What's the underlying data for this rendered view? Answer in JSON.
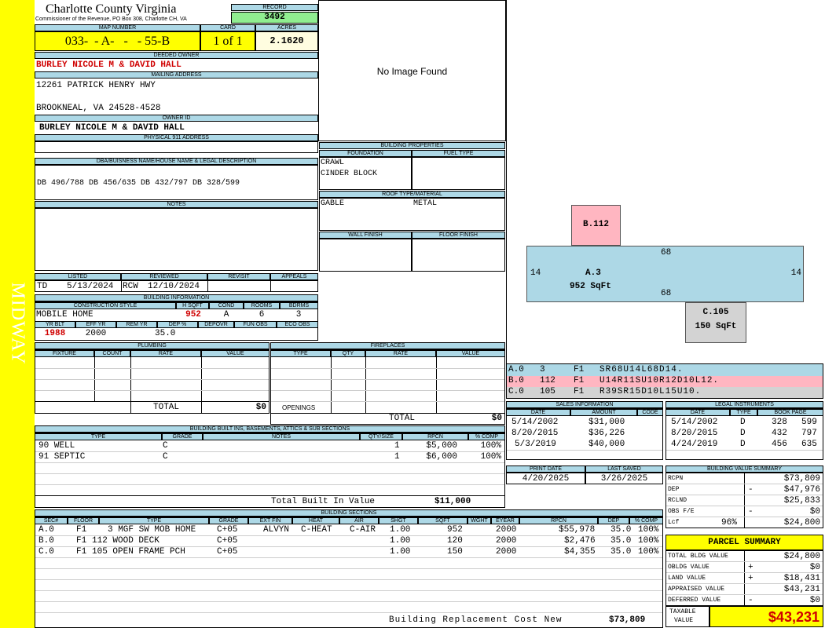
{
  "side_label": "MIDWAY",
  "county": {
    "name": "Charlotte County Virginia",
    "sub": "Commissioner of the Revenue, PO Box 308, Charlotte CH, VA"
  },
  "record": {
    "label": "RECORD",
    "value": "3492"
  },
  "map": {
    "label": "MAP NUMBER",
    "value": "033-  - A-   -   - 55-B",
    "card_label": "CARD",
    "card": "1 of 1",
    "acres_label": "ACRES",
    "acres": "2.1620"
  },
  "owner": {
    "deeded_label": "DEEDED OWNER",
    "deeded": "BURLEY NICOLE M & DAVID HALL",
    "mailing_label": "MAILING ADDRESS",
    "addr1": "12261 PATRICK HENRY HWY",
    "addr2": "BROOKNEAL, VA 24528-4528",
    "id_label": "OWNER ID",
    "id_value": "BURLEY NICOLE M & DAVID HALL",
    "phys_label": "PHYSICAL 911 ADDRESS"
  },
  "legal": {
    "label": "DBA/BUISNESS NAME/HOUSE NAME & LEGAL DESCRIPTION",
    "value": "DB 496/788 DB 456/635 DB 432/797 DB 328/599"
  },
  "notes_label": "NOTES",
  "image_text": "No Image Found",
  "review": {
    "listed_label": "LISTED",
    "listed_by": "TD",
    "listed": "5/13/2024",
    "reviewed_label": "REVIEWED",
    "reviewed_by": "RCW",
    "reviewed": "12/10/2024",
    "revisit_label": "REVISIT",
    "appeals_label": "APPEALS"
  },
  "building_info": {
    "label": "BUILDING INFORMATION",
    "style_label": "CONSTRUCTION STYLE",
    "style": "MOBILE HOME",
    "hsqft_label": "H SQFT",
    "hsqft": "952",
    "cond_label": "COND",
    "cond": "A",
    "rooms_label": "ROOMS",
    "rooms": "6",
    "bdrms_label": "BDRMS",
    "bdrms": "3",
    "yrblt_label": "YR BLT",
    "yrblt": "1988",
    "effyr_label": "EFF YR",
    "effyr": "2000",
    "remyr_label": "REM YR",
    "deppct_label": "DEP %",
    "deppct": "35.0",
    "depovr_label": "DEPOVR",
    "funobs_label": "FUN OBS",
    "ecoobs_label": "ECO OBS"
  },
  "props": {
    "label": "BUILDING PROPERTIES",
    "foundation_label": "FOUNDATION",
    "foundation1": "CRAWL",
    "foundation2": "CINDER BLOCK",
    "fuel_label": "FUEL TYPE",
    "roof_label": "ROOF TYPE/MATERIAL",
    "roof_type": "GABLE",
    "roof_mat": "METAL",
    "wall_label": "WALL FINISH",
    "floor_label": "FLOOR FINISH"
  },
  "sketch": {
    "b_label": "B.112",
    "a_label": "A.3",
    "a_area": "952 SqFt",
    "a_top": "68",
    "a_bottom": "68",
    "a_left": "14",
    "a_right": "14",
    "c_label": "C.105",
    "c_area": "150 SqFt",
    "colors": {
      "a": "#add8e6",
      "b": "#ffb6c1",
      "c": "#d3d3d3"
    }
  },
  "sketch_codes": [
    {
      "id": "A.0",
      "num": "3",
      "fl": "F1",
      "code": "SR68U14L68D14."
    },
    {
      "id": "B.0",
      "num": "112",
      "fl": "F1",
      "code": "U14R11SU10R12D10L12."
    },
    {
      "id": "C.0",
      "num": "105",
      "fl": "F1",
      "code": "R39SR15D10L15U10."
    }
  ],
  "plumbing": {
    "label": "PLUMBING",
    "cols": [
      "FIXTURE",
      "COUNT",
      "RATE",
      "VALUE"
    ],
    "total_label": "TOTAL",
    "total": "$0"
  },
  "fireplaces": {
    "label": "FIREPLACES",
    "cols": [
      "TYPE",
      "QTY",
      "RATE",
      "VALUE"
    ],
    "openings_label": "OPENINGS",
    "total_label": "TOTAL",
    "total": "$0"
  },
  "sales": {
    "label": "SALES INFORMATION",
    "cols": [
      "DATE",
      "AMOUNT",
      "CODE"
    ],
    "rows": [
      {
        "date": "5/14/2002",
        "amount": "$31,000",
        "code": ""
      },
      {
        "date": "8/20/2015",
        "amount": "$36,226",
        "code": ""
      },
      {
        "date": "5/3/2019",
        "amount": "$40,000",
        "code": ""
      }
    ]
  },
  "legal_instr": {
    "label": "LEGAL INSTRUMENTS",
    "cols": [
      "DATE",
      "TYPE",
      "BOOK PAGE"
    ],
    "rows": [
      {
        "date": "5/14/2002",
        "type": "D",
        "book": "328",
        "page": "599"
      },
      {
        "date": "8/20/2015",
        "type": "D",
        "book": "432",
        "page": "797"
      },
      {
        "date": "4/24/2019",
        "type": "D",
        "book": "456",
        "page": "635"
      }
    ]
  },
  "print": {
    "print_label": "PRINT DATE",
    "print_date": "4/20/2025",
    "saved_label": "LAST SAVED",
    "saved_date": "3/26/2025"
  },
  "bvs": {
    "label": "BUILDING VALUE SUMMARY",
    "rows": [
      {
        "label": "RCPN",
        "sign": "",
        "pct": "",
        "value": "$73,809"
      },
      {
        "label": "DEP",
        "sign": "-",
        "pct": "",
        "value": "$47,976"
      },
      {
        "label": "RCLND",
        "sign": "",
        "pct": "",
        "value": "$25,833"
      },
      {
        "label": "OBS F/E",
        "sign": "-",
        "pct": "",
        "value": "$0"
      },
      {
        "label": "Lcf",
        "sign": "",
        "pct": "96%",
        "value": "$24,800"
      }
    ]
  },
  "parcel": {
    "label": "PARCEL SUMMARY",
    "rows": [
      {
        "label": "TOTAL BLDG VALUE",
        "sign": "",
        "value": "$24,800"
      },
      {
        "label": "OBLDG VALUE",
        "sign": "+",
        "value": "$0"
      },
      {
        "label": "LAND VALUE",
        "sign": "+",
        "value": "$18,431"
      },
      {
        "label": "APPRAISED VALUE",
        "sign": "",
        "value": "$43,231"
      },
      {
        "label": "DEFERRED VALUE",
        "sign": "-",
        "value": "$0"
      }
    ],
    "taxable_label1": "TAXABLE",
    "taxable_label2": "VALUE",
    "taxable": "$43,231"
  },
  "builtins": {
    "label": "BUILDING BUILT INS, BASEMENTS, ATTICS & SUB SECTIONS",
    "cols": [
      "TYPE",
      "GRADE",
      "NOTES",
      "QTY/SIZE",
      "RPCN",
      "% COMP"
    ],
    "rows": [
      {
        "type": "90 WELL",
        "grade": "C",
        "notes": "",
        "qty": "1",
        "rpcn": "$5,000",
        "comp": "100%"
      },
      {
        "type": "91 SEPTIC",
        "grade": "C",
        "notes": "",
        "qty": "1",
        "rpcn": "$6,000",
        "comp": "100%"
      }
    ],
    "total_label": "Total Built In Value",
    "total": "$11,000"
  },
  "sections": {
    "label": "BUILDING SECTIONS",
    "cols": [
      "SEC#",
      "FLOOR",
      "TYPE",
      "GRADE",
      "EXT FIN",
      "HEAT",
      "AIR",
      "SHGT",
      "SQFT",
      "WGHT",
      "EYEAR",
      "RPCN",
      "DEP",
      "% COMP"
    ],
    "rows": [
      {
        "sec": "A.0",
        "floor": "F1",
        "type": "3 MGF SW MOB HOME",
        "grade": "C+05",
        "ext": "ALVYN",
        "heat": "C-HEAT",
        "air": "C-AIR",
        "shgt": "1.00",
        "sqft": "952",
        "wght": "",
        "eyear": "2000",
        "rpcn": "$55,978",
        "dep": "35.0",
        "comp": "100%"
      },
      {
        "sec": "B.0",
        "floor": "F1",
        "type": "112 WOOD DECK",
        "grade": "C+05",
        "ext": "",
        "heat": "",
        "air": "",
        "shgt": "1.00",
        "sqft": "120",
        "wght": "",
        "eyear": "2000",
        "rpcn": "$2,476",
        "dep": "35.0",
        "comp": "100%"
      },
      {
        "sec": "C.0",
        "floor": "F1",
        "type": "105 OPEN FRAME PCH",
        "grade": "C+05",
        "ext": "",
        "heat": "",
        "air": "",
        "shgt": "1.00",
        "sqft": "150",
        "wght": "",
        "eyear": "2000",
        "rpcn": "$4,355",
        "dep": "35.0",
        "comp": "100%"
      }
    ],
    "total_label": "Building Replacement Cost New",
    "total": "$73,809"
  }
}
